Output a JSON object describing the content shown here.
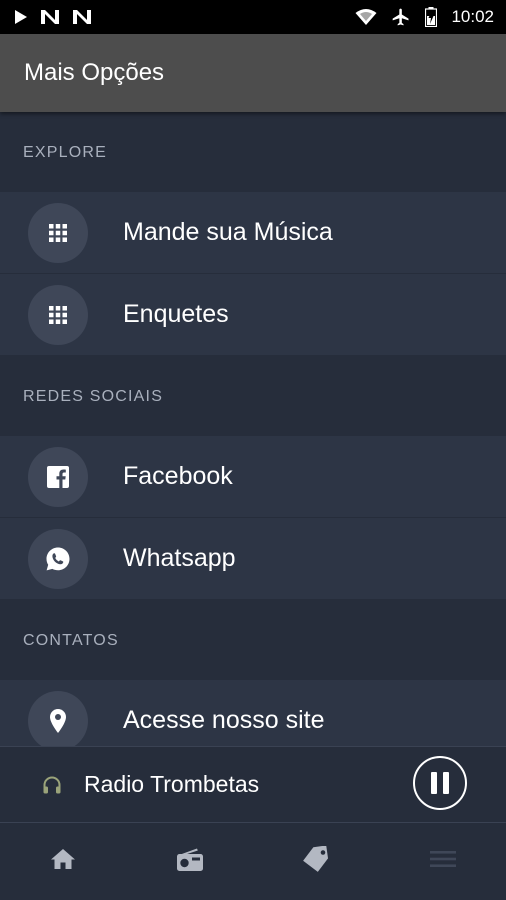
{
  "status_bar": {
    "time": "10:02",
    "left_icons": [
      "play-store-icon",
      "n-notification-icon",
      "n-notification-icon"
    ],
    "right_icons": [
      "wifi-icon",
      "airplane-icon",
      "battery-charging-icon"
    ]
  },
  "app_bar": {
    "title": "Mais Opções"
  },
  "sections": [
    {
      "header": "EXPLORE",
      "items": [
        {
          "label": "Mande sua Música",
          "icon": "grid-icon"
        },
        {
          "label": "Enquetes",
          "icon": "grid-icon"
        }
      ]
    },
    {
      "header": "REDES SOCIAIS",
      "items": [
        {
          "label": "Facebook",
          "icon": "facebook-icon"
        },
        {
          "label": "Whatsapp",
          "icon": "whatsapp-icon"
        }
      ]
    },
    {
      "header": "CONTATOS",
      "items": [
        {
          "label": "Acesse nosso site",
          "icon": "location-pin-icon"
        }
      ]
    }
  ],
  "player": {
    "title": "Radio Trombetas",
    "state": "playing"
  },
  "bottom_nav": [
    "home-icon",
    "radio-icon",
    "tag-icon",
    "menu-icon"
  ],
  "colors": {
    "background": "#262d3b",
    "row": "#2d3545",
    "app_bar": "#4d4d4d",
    "icon_circle": "#3f4758",
    "section_text": "#a9b0bd"
  }
}
